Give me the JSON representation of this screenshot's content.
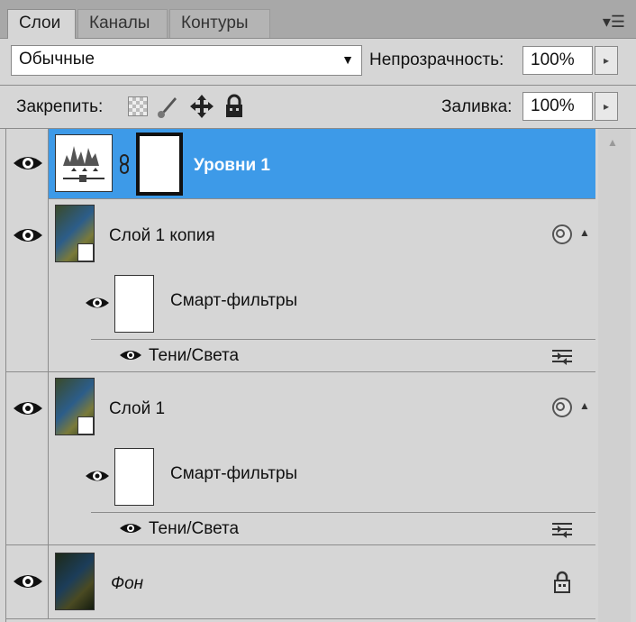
{
  "tabs": [
    {
      "label": "Слои",
      "active": true
    },
    {
      "label": "Каналы",
      "active": false
    },
    {
      "label": "Контуры",
      "active": false
    }
  ],
  "blend_mode": "Обычные",
  "opacity": {
    "label": "Непрозрачность:",
    "value": "100%"
  },
  "lock": {
    "label": "Закрепить:"
  },
  "fill": {
    "label": "Заливка:",
    "value": "100%"
  },
  "layers": [
    {
      "name": "Уровни 1",
      "type": "adjustment",
      "selected": true
    },
    {
      "name": "Слой 1 копия",
      "type": "smart-object",
      "filters_label": "Смарт-фильтры",
      "filter": "Тени/Света"
    },
    {
      "name": "Слой 1",
      "type": "smart-object",
      "filters_label": "Смарт-фильтры",
      "filter": "Тени/Света"
    },
    {
      "name": "Фон",
      "type": "background",
      "locked": true
    }
  ],
  "colors": {
    "selection": "#3d9ae8",
    "panel": "#d6d6d6"
  }
}
